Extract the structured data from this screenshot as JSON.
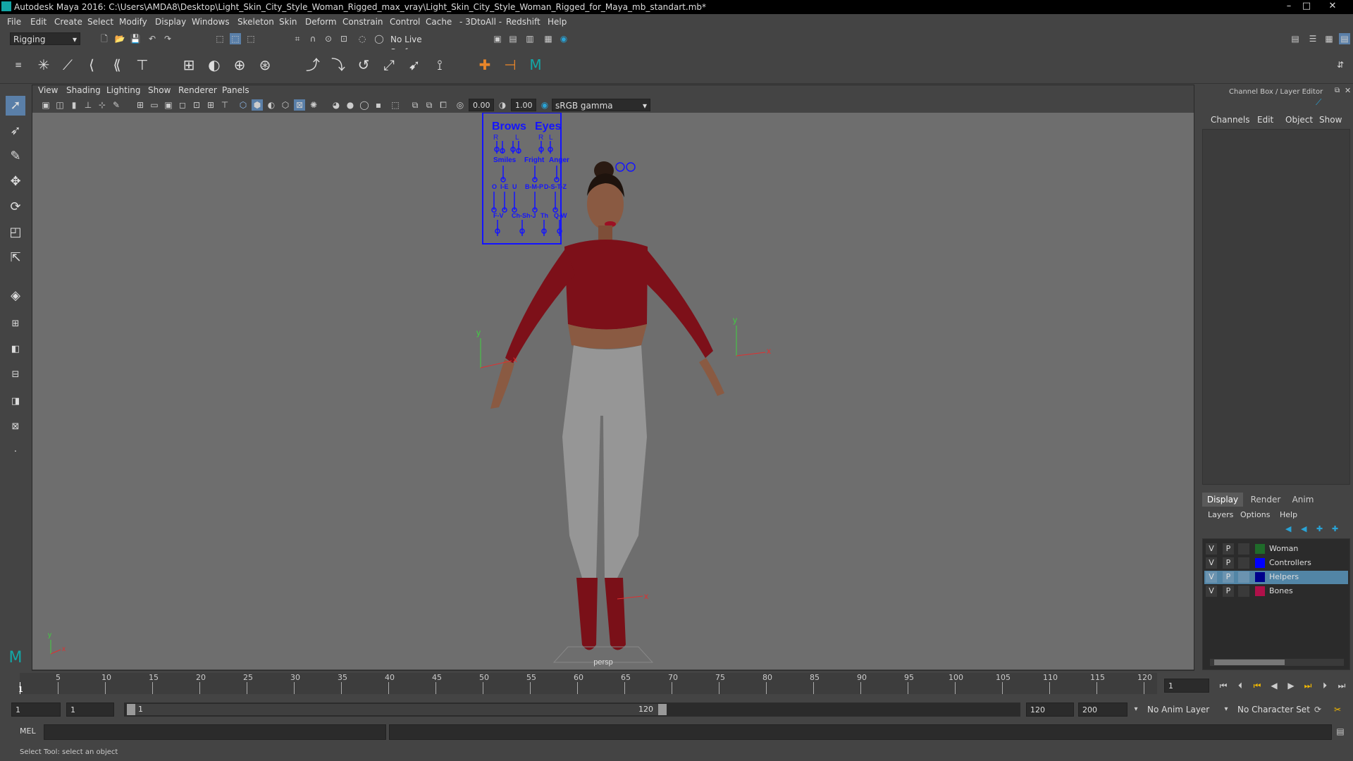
{
  "title_bar": {
    "text": "Autodesk Maya 2016: C:\\Users\\AMDA8\\Desktop\\Light_Skin_City_Style_Woman_Rigged_max_vray\\Light_Skin_City_Style_Woman_Rigged_for_Maya_mb_standart.mb*",
    "minimize": "–",
    "maximize": "□",
    "close": "✕"
  },
  "menu": [
    "File",
    "Edit",
    "Create",
    "Select",
    "Modify",
    "Display",
    "Windows",
    "Skeleton",
    "Skin",
    "Deform",
    "Constrain",
    "Control",
    "Cache",
    "- 3DtoAll -",
    "Redshift",
    "Help"
  ],
  "status_line": {
    "menuset": "Rigging",
    "live_surface": "No Live Surface"
  },
  "viewport": {
    "menu": [
      "View",
      "Shading",
      "Lighting",
      "Show",
      "Renderer",
      "Panels"
    ],
    "exposure": "0.00",
    "gamma": "1.00",
    "colorspace": "sRGB gamma",
    "camera_label": "persp",
    "face_ui": {
      "brows": "Brows",
      "eyes": "Eyes",
      "r1": "R",
      "l1": "L",
      "r2": "R",
      "l2": "L",
      "row2": [
        "Smiles",
        "Fright",
        "Anger"
      ],
      "row3": [
        "O",
        "I-E",
        "U",
        "B-M-P",
        "D-S-T-Z"
      ],
      "row4": [
        "F-V",
        "Ch-Sh-J",
        "Th",
        "Q-W"
      ]
    },
    "axis_x": "x",
    "axis_y": "y",
    "axis_z": "z"
  },
  "channel_box": {
    "title": "Channel Box / Layer Editor",
    "menu": [
      "Channels",
      "Edit",
      "Object",
      "Show"
    ]
  },
  "layer_editor": {
    "tabs": [
      "Display",
      "Render",
      "Anim"
    ],
    "menu": [
      "Layers",
      "Options",
      "Help"
    ],
    "layers": [
      {
        "v": "V",
        "p": "P",
        "name": "Woman",
        "color": "#1f6b2a"
      },
      {
        "v": "V",
        "p": "P",
        "name": "Controllers",
        "color": "#0000ff"
      },
      {
        "v": "V",
        "p": "P",
        "name": "Helpers",
        "color": "#00008b"
      },
      {
        "v": "V",
        "p": "P",
        "name": "Bones",
        "color": "#b0104a"
      }
    ],
    "selected_layer": "Helpers"
  },
  "timeline": {
    "ticks": [
      "1",
      "5",
      "10",
      "15",
      "20",
      "25",
      "30",
      "35",
      "40",
      "45",
      "50",
      "55",
      "60",
      "65",
      "70",
      "75",
      "80",
      "85",
      "90",
      "95",
      "100",
      "105",
      "110",
      "115",
      "120"
    ],
    "current_frame": "1"
  },
  "range": {
    "start": "1",
    "playback_start": "1",
    "slider_start": "1",
    "slider_end": "120",
    "playback_end": "120",
    "end": "200",
    "anim_layer": "No Anim Layer",
    "character_set": "No Character Set"
  },
  "command": {
    "label": "MEL"
  },
  "help_line": "Select Tool: select an object"
}
